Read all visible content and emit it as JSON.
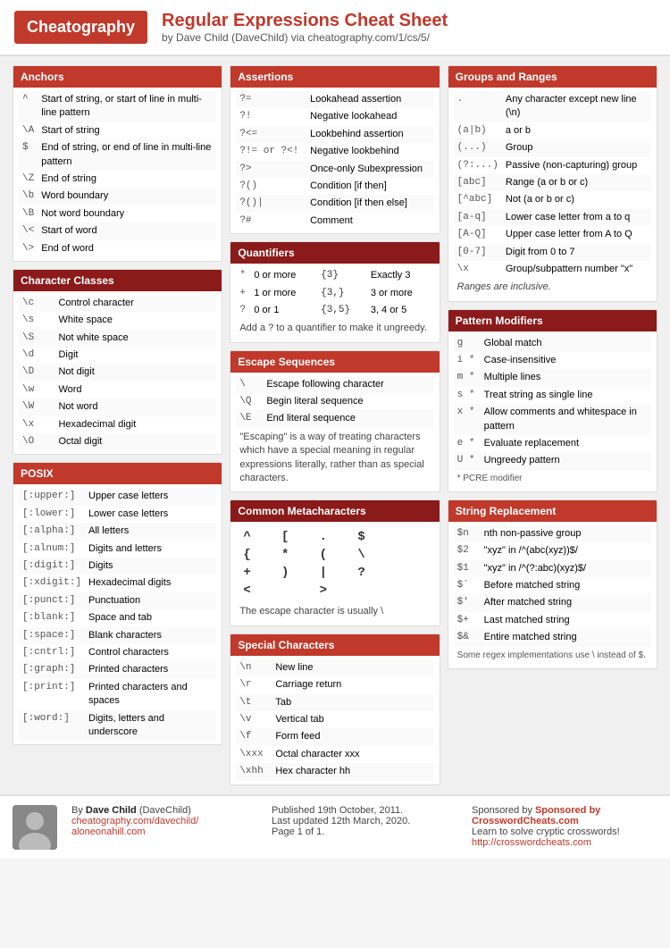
{
  "header": {
    "logo": "Cheatography",
    "title": "Regular Expressions Cheat Sheet",
    "subtitle": "by Dave Child (DaveChild) via cheatography.com/1/cs/5/"
  },
  "anchors": {
    "title": "Anchors",
    "rows": [
      {
        "sym": "^",
        "desc": "Start of string, or start of line in multi-line pattern"
      },
      {
        "sym": "\\A",
        "desc": "Start of string"
      },
      {
        "sym": "$",
        "desc": "End of string, or end of line in multi-line pattern"
      },
      {
        "sym": "\\Z",
        "desc": "End of string"
      },
      {
        "sym": "\\b",
        "desc": "Word boundary"
      },
      {
        "sym": "\\B",
        "desc": "Not word boundary"
      },
      {
        "sym": "\\<",
        "desc": "Start of word"
      },
      {
        "sym": "\\>",
        "desc": "End of word"
      }
    ]
  },
  "charClasses": {
    "title": "Character Classes",
    "rows": [
      {
        "sym": "\\c",
        "desc": "Control character"
      },
      {
        "sym": "\\s",
        "desc": "White space"
      },
      {
        "sym": "\\S",
        "desc": "Not white space"
      },
      {
        "sym": "\\d",
        "desc": "Digit"
      },
      {
        "sym": "\\D",
        "desc": "Not digit"
      },
      {
        "sym": "\\w",
        "desc": "Word"
      },
      {
        "sym": "\\W",
        "desc": "Not word"
      },
      {
        "sym": "\\x",
        "desc": "Hexadecimal digit"
      },
      {
        "sym": "\\O",
        "desc": "Octal digit"
      }
    ]
  },
  "posix": {
    "title": "POSIX",
    "rows": [
      {
        "sym": "[:upper:]",
        "desc": "Upper case letters"
      },
      {
        "sym": "[:lower:]",
        "desc": "Lower case letters"
      },
      {
        "sym": "[:alpha:]",
        "desc": "All letters"
      },
      {
        "sym": "[:alnum:]",
        "desc": "Digits and letters"
      },
      {
        "sym": "[:digit:]",
        "desc": "Digits"
      },
      {
        "sym": "[:xdigit:]",
        "desc": "Hexadecimal digits"
      },
      {
        "sym": "[:punct:]",
        "desc": "Punctuation"
      },
      {
        "sym": "[:blank:]",
        "desc": "Space and tab"
      },
      {
        "sym": "[:space:]",
        "desc": "Blank characters"
      },
      {
        "sym": "[:cntrl:]",
        "desc": "Control characters"
      },
      {
        "sym": "[:graph:]",
        "desc": "Printed characters"
      },
      {
        "sym": "[:print:]",
        "desc": "Printed characters and spaces"
      },
      {
        "sym": "[:word:]",
        "desc": "Digits, letters and underscore"
      }
    ]
  },
  "assertions": {
    "title": "Assertions",
    "rows": [
      {
        "sym": "?=",
        "desc": "Lookahead assertion"
      },
      {
        "sym": "?!",
        "desc": "Negative lookahead"
      },
      {
        "sym": "?<=",
        "desc": "Lookbehind assertion"
      },
      {
        "sym": "?!= or ?<!",
        "desc": "Negative lookbehind"
      },
      {
        "sym": "?>",
        "desc": "Once-only Subexpression"
      },
      {
        "sym": "?()",
        "desc": "Condition [if then]"
      },
      {
        "sym": "?()|",
        "desc": "Condition [if then else]"
      },
      {
        "sym": "?#",
        "desc": "Comment"
      }
    ]
  },
  "quantifiers": {
    "title": "Quantifiers",
    "rows": [
      {
        "sym": "*",
        "desc": "0 or more",
        "sym2": "{3}",
        "desc2": "Exactly 3"
      },
      {
        "sym": "+",
        "desc": "1 or more",
        "sym2": "{3,}",
        "desc2": "3 or more"
      },
      {
        "sym": "?",
        "desc": "0 or 1",
        "sym2": "{3,5}",
        "desc2": "3, 4 or 5"
      }
    ],
    "note": "Add a ? to a quantifier to make it ungreedy."
  },
  "escapeSeq": {
    "title": "Escape Sequences",
    "rows": [
      {
        "sym": "\\",
        "desc": "Escape following character"
      },
      {
        "sym": "\\Q",
        "desc": "Begin literal sequence"
      },
      {
        "sym": "\\E",
        "desc": "End literal sequence"
      }
    ],
    "note": "\"Escaping\" is a way of treating characters which have a special meaning in regular expressions literally, rather than as special characters."
  },
  "commonMeta": {
    "title": "Common Metacharacters",
    "chars": [
      "^",
      "[",
      ".",
      "$",
      "{",
      "*",
      "(",
      "\\",
      "+",
      ")",
      "|",
      "?",
      "<",
      ">"
    ],
    "note": "The escape character is usually \\"
  },
  "specialChars": {
    "title": "Special Characters",
    "rows": [
      {
        "sym": "\\n",
        "desc": "New line"
      },
      {
        "sym": "\\r",
        "desc": "Carriage return"
      },
      {
        "sym": "\\t",
        "desc": "Tab"
      },
      {
        "sym": "\\v",
        "desc": "Vertical tab"
      },
      {
        "sym": "\\f",
        "desc": "Form feed"
      },
      {
        "sym": "\\xxx",
        "desc": "Octal character xxx"
      },
      {
        "sym": "\\xhh",
        "desc": "Hex character hh"
      }
    ]
  },
  "groupsRanges": {
    "title": "Groups and Ranges",
    "rows": [
      {
        "sym": ".",
        "desc": "Any character except new line (\\n)"
      },
      {
        "sym": "(a|b)",
        "desc": "a or b"
      },
      {
        "sym": "(...)",
        "desc": "Group"
      },
      {
        "sym": "(?:...)",
        "desc": "Passive (non-capturing) group"
      },
      {
        "sym": "[abc]",
        "desc": "Range (a or b or c)"
      },
      {
        "sym": "[^abc]",
        "desc": "Not (a or b or c)"
      },
      {
        "sym": "[a-q]",
        "desc": "Lower case letter from a to q"
      },
      {
        "sym": "[A-Q]",
        "desc": "Upper case letter from A to Q"
      },
      {
        "sym": "[0-7]",
        "desc": "Digit from 0 to 7"
      },
      {
        "sym": "\\x",
        "desc": "Group/subpattern number \"x\""
      }
    ],
    "note": "Ranges are inclusive."
  },
  "patternMod": {
    "title": "Pattern Modifiers",
    "rows": [
      {
        "sym": "g",
        "desc": "Global match"
      },
      {
        "sym": "i *",
        "desc": "Case-insensitive"
      },
      {
        "sym": "m *",
        "desc": "Multiple lines"
      },
      {
        "sym": "s *",
        "desc": "Treat string as single line"
      },
      {
        "sym": "x *",
        "desc": "Allow comments and whitespace in pattern"
      },
      {
        "sym": "e *",
        "desc": "Evaluate replacement"
      },
      {
        "sym": "U *",
        "desc": "Ungreedy pattern"
      }
    ],
    "note": "* PCRE modifier"
  },
  "stringReplace": {
    "title": "String Replacement",
    "rows": [
      {
        "sym": "$n",
        "desc": "nth non-passive group"
      },
      {
        "sym": "$2",
        "desc": "\"xyz\" in /^(abc(xyz))$/"
      },
      {
        "sym": "$1",
        "desc": "\"xyz\" in /^(?:abc)(xyz)$/"
      },
      {
        "sym": "$`",
        "desc": "Before matched string"
      },
      {
        "sym": "$'",
        "desc": "After matched string"
      },
      {
        "sym": "$+",
        "desc": "Last matched string"
      },
      {
        "sym": "$&",
        "desc": "Entire matched string"
      }
    ],
    "note": "Some regex implementations use \\ instead of $."
  },
  "footer": {
    "author": "Dave Child",
    "authorExtra": "(DaveChild)",
    "links": [
      "cheatography.com/davechild/",
      "aloneonahill.com"
    ],
    "published": "Published 19th October, 2011.",
    "updated": "Last updated 12th March, 2020.",
    "page": "Page 1 of 1.",
    "sponsor": "Sponsored by CrosswordCheats.com",
    "sponsorDesc": "Learn to solve cryptic crosswords!",
    "sponsorLink": "http://crosswordcheats.com"
  }
}
